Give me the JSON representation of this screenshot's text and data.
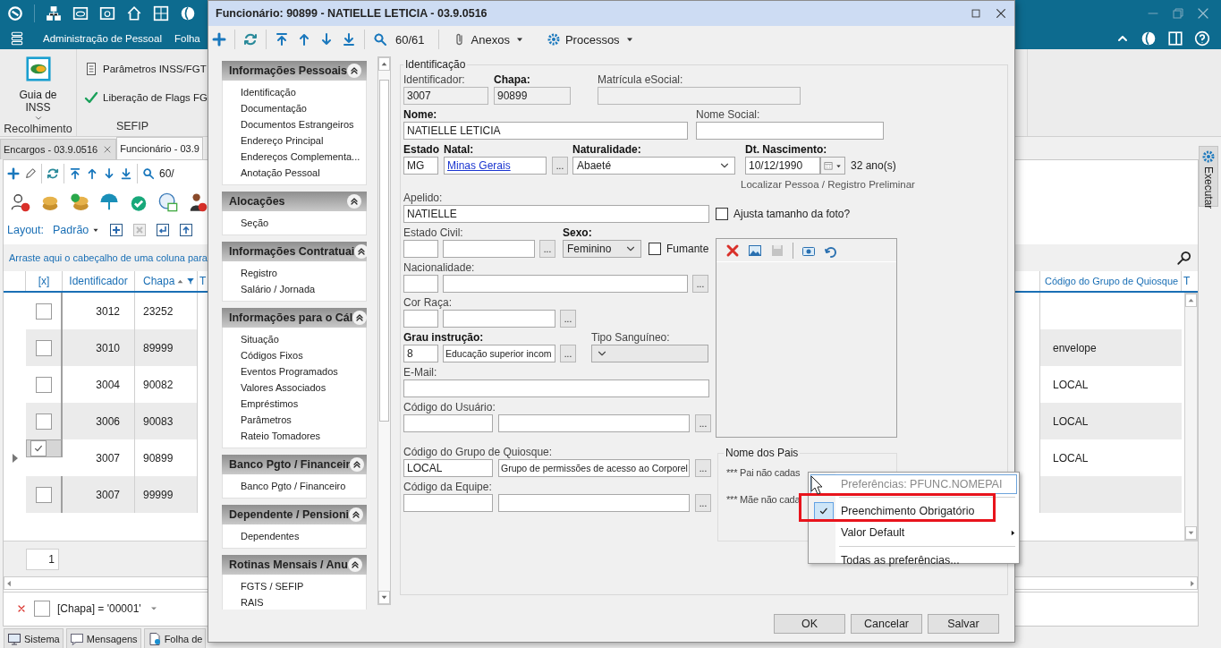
{
  "menu_bar": {
    "items": [
      {
        "label": "Administração de Pessoal"
      },
      {
        "label": "Folha"
      }
    ]
  },
  "ribbon": {
    "groups": [
      {
        "label": "Recolhimento",
        "buttons": [
          {
            "label": "Guia de INSS"
          }
        ]
      },
      {
        "label": "SEFIP",
        "buttons": [
          {
            "label": "Parâmetros INSS/FGT"
          },
          {
            "label": "Liberação de Flags FG"
          }
        ]
      }
    ]
  },
  "doc_tabs": [
    {
      "label": "Encargos - 03.9.0516",
      "selected": false,
      "closable": true
    },
    {
      "label": "Funcionário - 03.9",
      "selected": true,
      "closable": false
    }
  ],
  "toolbar": {
    "counter": "60/"
  },
  "layout_bar": {
    "label": "Layout:",
    "value": "Padrão"
  },
  "group_panel": {
    "hint": "Arraste aqui o cabeçalho de uma coluna para"
  },
  "grid": {
    "columns": [
      {
        "label": "[x]"
      },
      {
        "label": "Identificador"
      },
      {
        "label": "Chapa",
        "sorted": true
      },
      {
        "label": "T"
      }
    ],
    "right_columns": [
      {
        "label": "Código do Grupo de Quiosque"
      },
      {
        "label": "T"
      }
    ],
    "rows": [
      {
        "checked": false,
        "selected": false,
        "id": "3012",
        "chapa": "23252"
      },
      {
        "checked": false,
        "selected": false,
        "id": "3010",
        "chapa": "89999",
        "kiosk": "envelope"
      },
      {
        "checked": false,
        "selected": false,
        "id": "3004",
        "chapa": "90082",
        "kiosk": "LOCAL"
      },
      {
        "checked": false,
        "selected": false,
        "id": "3006",
        "chapa": "90083",
        "kiosk": "LOCAL"
      },
      {
        "checked": true,
        "selected": true,
        "id": "3007",
        "chapa": "90899",
        "kiosk": "LOCAL"
      },
      {
        "checked": false,
        "selected": false,
        "id": "3007",
        "chapa": "99999"
      }
    ]
  },
  "pager": {
    "page": "1"
  },
  "filter_bar": {
    "enabled": false,
    "expression": "[Chapa] = '00001'"
  },
  "bottom_tabs": [
    {
      "label": "Sistema"
    },
    {
      "label": "Mensagens"
    },
    {
      "label": "Folha de"
    }
  ],
  "side_tab": {
    "label": "Executar"
  },
  "dialog": {
    "title": "Funcionário: 90899 - NATIELLE LETICIA - 03.9.0516",
    "counter": "60/61",
    "menus": [
      {
        "label": "Anexos",
        "kind": "attach"
      },
      {
        "label": "Processos",
        "kind": "gear"
      }
    ],
    "nav": [
      {
        "title": "Informações Pessoais",
        "expanded": true,
        "items": [
          "Identificação",
          "Documentação",
          "Documentos Estrangeiros",
          "Endereço Principal",
          "Endereços Complementa...",
          "Anotação Pessoal"
        ]
      },
      {
        "title": "Alocações",
        "expanded": true,
        "items": [
          "Seção"
        ]
      },
      {
        "title": "Informações Contratuai",
        "expanded": true,
        "items": [
          "Registro",
          "Salário / Jornada"
        ]
      },
      {
        "title": "Informações para o Cál",
        "expanded": true,
        "items": [
          "Situação",
          "Códigos Fixos",
          "Eventos Programados",
          "Valores Associados",
          "Empréstimos",
          "Parâmetros",
          "Rateio Tomadores"
        ]
      },
      {
        "title": "Banco Pgto / Financeir",
        "expanded": true,
        "items": [
          "Banco Pgto / Financeiro"
        ]
      },
      {
        "title": "Dependente / Pensioni",
        "expanded": true,
        "items": [
          "Dependentes"
        ]
      },
      {
        "title": "Rotinas Mensais / Anu",
        "expanded": true,
        "items": [
          "FGTS / SEFIP",
          "RAIS"
        ]
      }
    ],
    "form": {
      "group": "Identificação",
      "identificador": {
        "label": "Identificador:",
        "value": "3007",
        "required": false,
        "disabled": true
      },
      "chapa": {
        "label": "Chapa:",
        "value": "90899",
        "required": true,
        "disabled": true
      },
      "matricula_esocial": {
        "label": "Matrícula eSocial:",
        "required": false,
        "disabled": true
      },
      "nome": {
        "label": "Nome:",
        "value": "NATIELLE LETICIA",
        "required": true
      },
      "nome_social": {
        "label": "Nome Social:",
        "required": false
      },
      "estado": {
        "label": "Estado",
        "value": "MG",
        "required": true
      },
      "natal": {
        "label": "Natal:",
        "value": "Minas Gerais",
        "required": true,
        "link": true,
        "lookup": "..."
      },
      "naturalidade": {
        "label": "Naturalidade:",
        "value": "Abaeté",
        "required": true
      },
      "nascimento": {
        "label": "Dt. Nascimento:",
        "value": "10/12/1990",
        "required": true,
        "age": "32 ano(s)"
      },
      "localizar_link": "Localizar Pessoa / Registro Preliminar",
      "apelido": {
        "label": "Apelido:",
        "value": "NATIELLE",
        "required": false
      },
      "ajusta_foto": {
        "label": "Ajusta tamanho da foto?",
        "checked": false
      },
      "estado_civil": {
        "label": "Estado Civil:",
        "required": false,
        "lookup": "..."
      },
      "sexo": {
        "label": "Sexo:",
        "value": "Feminino",
        "required": true
      },
      "fumante": {
        "label": "Fumante",
        "checked": false
      },
      "nacionalidade": {
        "label": "Nacionalidade:",
        "required": false,
        "lookup": "..."
      },
      "cor_raca": {
        "label": "Cor Raça:",
        "required": false,
        "lookup": "..."
      },
      "grau_instrucao": {
        "label": "Grau instrução:",
        "code": "8",
        "value": "Educação superior incom",
        "required": true,
        "lookup": "..."
      },
      "tipo_sanguineo": {
        "label": "Tipo Sanguíneo:",
        "required": false,
        "disabled": true
      },
      "email": {
        "label": "E-Mail:",
        "required": false
      },
      "codigo_usuario": {
        "label": "Código do Usuário:",
        "required": false,
        "lookup": "..."
      },
      "quiosque": {
        "label": "Código do Grupo de Quiosque:",
        "code": "LOCAL",
        "value": "Grupo de permissões de acesso ao Corporel",
        "required": false,
        "lookup": "..."
      },
      "equipe": {
        "label": "Código da Equipe:",
        "required": false,
        "lookup": "..."
      },
      "pais": {
        "title": "Nome dos Pais",
        "father": "*** Pai não cadas",
        "mother": "*** Mãe não cada"
      }
    },
    "buttons": [
      {
        "label": "OK"
      },
      {
        "label": "Cancelar"
      },
      {
        "label": "Salvar"
      }
    ]
  },
  "context_menu": {
    "header": "Preferências: PFUNC.NOMEPAI",
    "items": [
      {
        "label": "Preenchimento Obrigatório",
        "checked": true,
        "highlighted": true,
        "submenu": false,
        "separator_before": false
      },
      {
        "label": "Valor Default",
        "checked": false,
        "highlighted": false,
        "submenu": true,
        "separator_before": false
      },
      {
        "label": "Todas as preferências...",
        "checked": false,
        "highlighted": false,
        "submenu": false,
        "separator_before": true
      }
    ]
  }
}
